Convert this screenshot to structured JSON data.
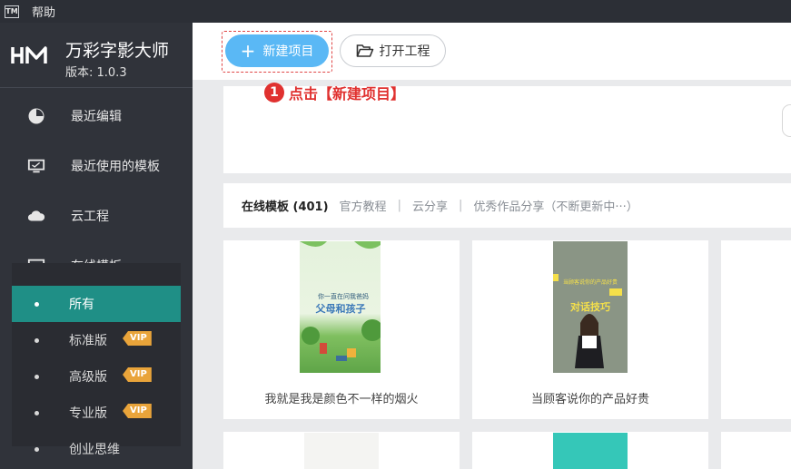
{
  "menubar": {
    "logo": "TM",
    "help": "帮助"
  },
  "brand": {
    "name": "万彩字影大师",
    "version": "版本: 1.0.3"
  },
  "nav": [
    {
      "label": "最近编辑",
      "icon": "recent-edit-icon"
    },
    {
      "label": "最近使用的模板",
      "icon": "monitor-icon"
    },
    {
      "label": "云工程",
      "icon": "cloud-icon"
    },
    {
      "label": "在线模板",
      "icon": "template-icon"
    }
  ],
  "sub_nav": [
    {
      "label": "所有",
      "vip": "",
      "active": true
    },
    {
      "label": "标准版",
      "vip": "VIP"
    },
    {
      "label": "高级版",
      "vip": "VIP"
    },
    {
      "label": "专业版",
      "vip": "VIP"
    },
    {
      "label": "创业思维",
      "vip": ""
    }
  ],
  "toolbar": {
    "new_project": "新建项目",
    "open_project": "打开工程"
  },
  "annotation": {
    "number": "1",
    "text": "点击【新建项目】"
  },
  "tabs": {
    "online": "在线模板 (401)",
    "official": "官方教程",
    "cloud_share": "云分享",
    "showcase": "优秀作品分享（不断更新中···）",
    "separator": "|"
  },
  "cards": [
    {
      "title": "我就是我是颜色不一样的烟火",
      "thumb_text_top": "你一直在问我爸妈",
      "thumb_text_main": "父母和孩子"
    },
    {
      "title": "当顾客说你的产品好贵",
      "thumb_text_top": "当顾客说你的产品好贵",
      "thumb_text_main": "对话技巧"
    }
  ],
  "colors": {
    "sidebar": "#30333a",
    "active_teal": "#1f8f86",
    "primary_blue": "#5ab8f5",
    "annotation_red": "#e0312f",
    "vip_orange": "#e9a43a"
  }
}
